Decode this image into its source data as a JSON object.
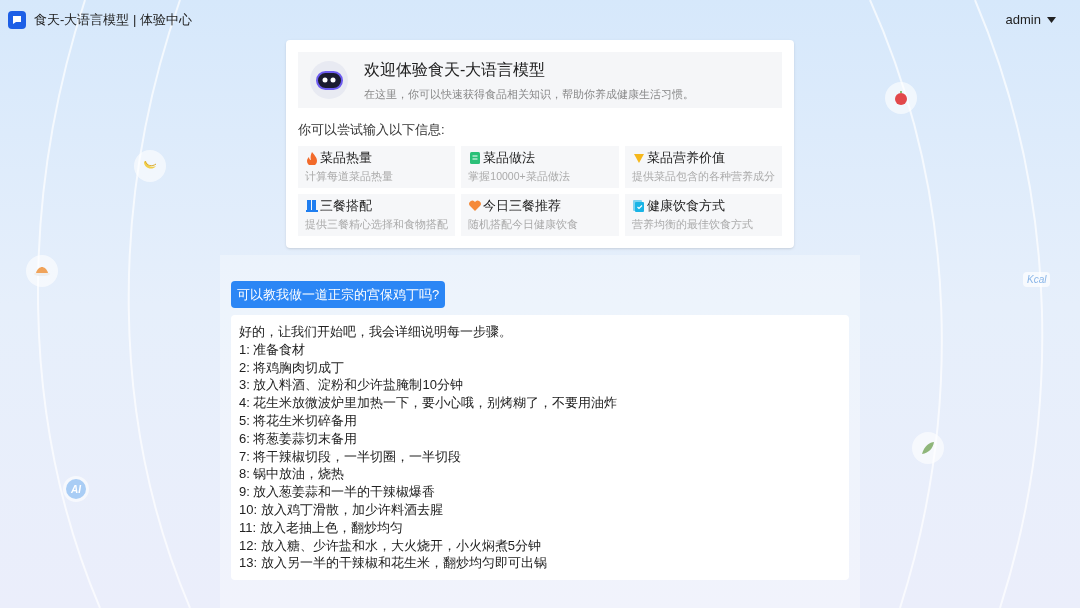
{
  "header": {
    "title": "食天-大语言模型 | 体验中心",
    "user": "admin"
  },
  "intro": {
    "title": "欢迎体验食天-大语言模型",
    "subtitle": "在这里，你可以快速获得食品相关知识，帮助你养成健康生活习惯。",
    "prompt": "你可以尝试输入以下信息:",
    "suggestions": [
      {
        "title": "菜品热量",
        "desc": "计算每道菜品热量"
      },
      {
        "title": "菜品做法",
        "desc": "掌握10000+菜品做法"
      },
      {
        "title": "菜品营养价值",
        "desc": "提供菜品包含的各种营养成分"
      },
      {
        "title": "三餐搭配",
        "desc": "提供三餐精心选择和食物搭配"
      },
      {
        "title": "今日三餐推荐",
        "desc": "随机搭配今日健康饮食"
      },
      {
        "title": "健康饮食方式",
        "desc": "营养均衡的最佳饮食方式"
      }
    ]
  },
  "chat": {
    "question": "可以教我做一道正宗的宫保鸡丁吗?",
    "answer": [
      "好的，让我们开始吧，我会详细说明每一步骤。",
      "1: 准备食材",
      "2: 将鸡胸肉切成丁",
      "3: 放入料酒、淀粉和少许盐腌制10分钟",
      "4: 花生米放微波炉里加热一下，要小心哦，别烤糊了，不要用油炸",
      "5: 将花生米切碎备用",
      "6: 将葱姜蒜切末备用",
      "7: 将干辣椒切段，一半切圈，一半切段",
      "8: 锅中放油，烧热",
      "9: 放入葱姜蒜和一半的干辣椒爆香",
      "10: 放入鸡丁滑散，加少许料酒去腥",
      "11: 放入老抽上色，翻炒均匀",
      "12: 放入糖、少许盐和水，大火烧开，小火焖煮5分钟",
      "13: 放入另一半的干辣椒和花生米，翻炒均匀即可出锅"
    ]
  },
  "decor": {
    "kcal_label": "Kcal",
    "ai_label": "AI"
  }
}
